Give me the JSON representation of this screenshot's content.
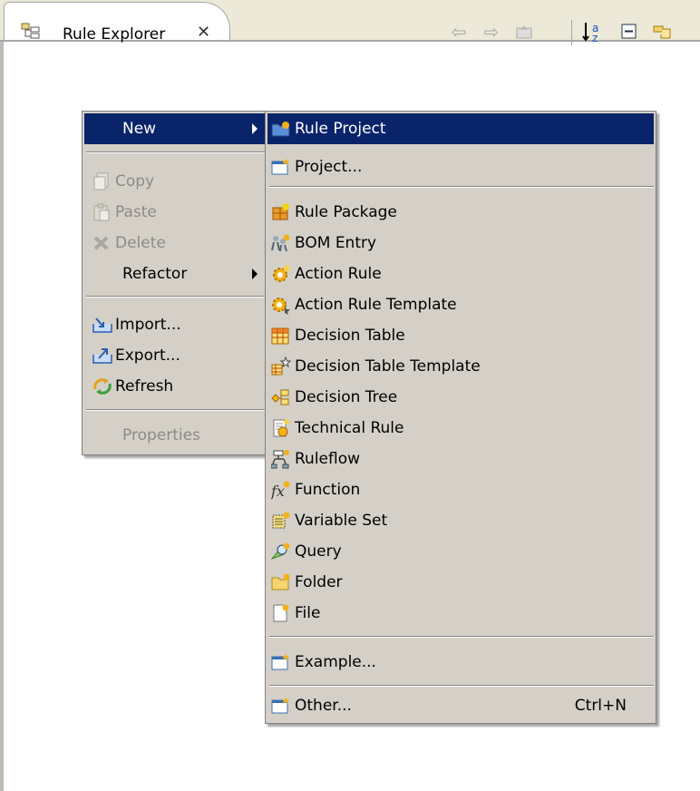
{
  "view": {
    "title": "Rule Explorer",
    "close_glyph": "✕",
    "toolbar_icons": [
      "back-arrow-icon",
      "forward-arrow-icon",
      "up-folder-icon",
      "sort-az-icon",
      "collapse-all-icon",
      "link-with-editor-icon"
    ]
  },
  "context_menu": {
    "items": {
      "new": "New",
      "copy": "Copy",
      "paste": "Paste",
      "delete": "Delete",
      "refactor": "Refactor",
      "import": "Import...",
      "export": "Export...",
      "refresh": "Refresh",
      "properties": "Properties"
    }
  },
  "new_submenu": {
    "items": {
      "rule_project": "Rule Project",
      "project": "Project...",
      "rule_package": "Rule Package",
      "bom_entry": "BOM Entry",
      "action_rule": "Action Rule",
      "action_rule_template": "Action Rule Template",
      "decision_table": "Decision Table",
      "decision_table_template": "Decision Table Template",
      "decision_tree": "Decision Tree",
      "technical_rule": "Technical Rule",
      "ruleflow": "Ruleflow",
      "function": "Function",
      "variable_set": "Variable Set",
      "query": "Query",
      "folder": "Folder",
      "file": "File",
      "example": "Example...",
      "other": "Other...",
      "other_shortcut": "Ctrl+N"
    }
  },
  "colors": {
    "highlight": "#0a246a",
    "menu_bg": "#d4d0c8",
    "disabled": "#8d8b84"
  }
}
